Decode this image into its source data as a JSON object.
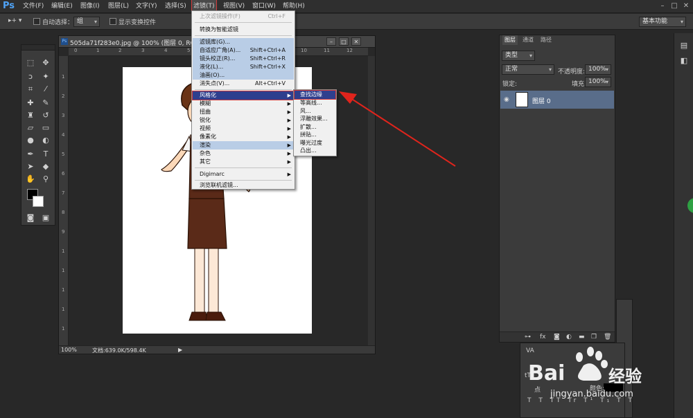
{
  "app": {
    "logo": "Ps"
  },
  "menubar": {
    "items": [
      "文件(F)",
      "编辑(E)",
      "图像(I)",
      "图层(L)",
      "文字(Y)",
      "选择(S)",
      "滤镜(T)",
      "视图(V)",
      "窗口(W)",
      "帮助(H)"
    ],
    "active": "滤镜(T)"
  },
  "options": {
    "auto_select_label": "自动选择：",
    "auto_select_value": "组",
    "show_transform_label": "显示变换控件",
    "workspace": "基本功能"
  },
  "document": {
    "title": "505da71f283e0.jpg @ 100% (图层 0, RGB/8...",
    "zoom": "100%",
    "file_info": "文档:639.0K/598.4K",
    "ruler_top": [
      "0",
      "1",
      "2",
      "3",
      "4",
      "5",
      "6",
      "7",
      "8",
      "9",
      "10",
      "11",
      "12"
    ],
    "ruler_left": [
      "1",
      "2",
      "3",
      "4",
      "5",
      "6",
      "7",
      "8",
      "9",
      "1",
      "1",
      "1",
      "1",
      "1",
      "1"
    ]
  },
  "filter_menu": {
    "last_filter": {
      "label": "上次滤镜操作(F)",
      "shortcut": "Ctrl+F"
    },
    "convert_smart": "转换为智能滤镜",
    "group1": [
      {
        "label": "滤镜库(G)...",
        "shortcut": ""
      },
      {
        "label": "自适应广角(A)...",
        "shortcut": "Shift+Ctrl+A"
      },
      {
        "label": "镜头校正(R)...",
        "shortcut": "Shift+Ctrl+R"
      },
      {
        "label": "液化(L)...",
        "shortcut": "Shift+Ctrl+X"
      },
      {
        "label": "油画(O)...",
        "shortcut": ""
      },
      {
        "label": "消失点(V)...",
        "shortcut": "Alt+Ctrl+V"
      }
    ],
    "group2": [
      "风格化",
      "模糊",
      "扭曲",
      "锐化",
      "视频",
      "像素化",
      "渲染",
      "杂色",
      "其它"
    ],
    "group3": [
      "Digimarc"
    ],
    "browse_online": "浏览联机滤镜..."
  },
  "stylize_submenu": {
    "items": [
      "查找边缘",
      "等高线...",
      "风...",
      "浮雕效果...",
      "扩散...",
      "拼贴...",
      "曝光过度",
      "凸出..."
    ]
  },
  "layers_panel": {
    "tabs": [
      "图层",
      "通道",
      "路径"
    ],
    "filter_kind": "类型",
    "blend_mode": "正常",
    "opacity_label": "不透明度:",
    "opacity_value": "100%",
    "lock_label": "锁定:",
    "fill_label": "填充:",
    "fill_value": "100%",
    "layer_name": "图层 0"
  },
  "char_panel": {
    "color_label": "颜色:",
    "size_hint": "点"
  },
  "watermark": {
    "brand": "Bai",
    "brand_cn": "经验",
    "url": "jingyan.baidu.com"
  },
  "colors": {
    "accent_red": "#d23b3b",
    "menu_highlight": "#2e3f8e"
  }
}
